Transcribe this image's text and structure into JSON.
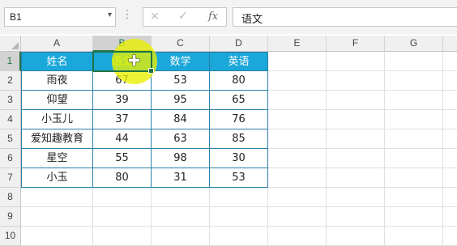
{
  "name_box": {
    "value": "B1"
  },
  "formula_bar": {
    "cancel_icon": "×",
    "enter_icon": "✓",
    "fx_label": "fx",
    "content": "语文"
  },
  "columns": [
    "A",
    "B",
    "C",
    "D",
    "E",
    "F",
    "G"
  ],
  "rows": [
    "1",
    "2",
    "3",
    "4",
    "5",
    "6",
    "7",
    "8",
    "9",
    "10"
  ],
  "table": {
    "headers": [
      "姓名",
      "语文",
      "数学",
      "英语"
    ],
    "records": [
      [
        "雨夜",
        "67",
        "53",
        "80"
      ],
      [
        "仰望",
        "39",
        "95",
        "65"
      ],
      [
        "小玉儿",
        "37",
        "84",
        "76"
      ],
      [
        "爱知趣教育",
        "44",
        "63",
        "85"
      ],
      [
        "星空",
        "55",
        "98",
        "30"
      ],
      [
        "小玉",
        "80",
        "31",
        "53"
      ]
    ]
  },
  "active_cell": "B1",
  "colors": {
    "header_fill": "#1aa7d9",
    "header_text": "#ffffff",
    "active_header_text": "#c8f03c",
    "table_border": "#2b7fa8",
    "selection": "#217346",
    "cursor_highlight": "#ebf000"
  }
}
